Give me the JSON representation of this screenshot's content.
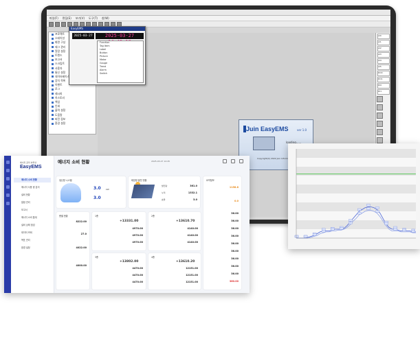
{
  "colors": {
    "accent": "#1a3fb8",
    "nav": "#2a3ba8",
    "clock": "#ff3a9a",
    "limit_line": "#2ec02e",
    "series_line": "#4a64d8"
  },
  "monitor_app": {
    "menu": [
      "파일(F)",
      "편집(E)",
      "보기(V)",
      "도구(T)",
      "창(W)"
    ],
    "tree_items": [
      "프로젝트",
      "스테이션",
      "화면 구성",
      "태그 관리",
      "알람 설정",
      "트렌드",
      "보고서",
      "스크립트",
      "사용자",
      "통신 설정",
      "데이터베이스",
      "장치 목록",
      "이벤트",
      "로그",
      "레시피",
      "히스토리",
      "백업",
      "인쇄",
      "출력 설정",
      "도움말",
      "버전 정보",
      "환경 설정"
    ],
    "clock_label": "2025-03-27",
    "clock": "2025-03-27 14:45:18",
    "popup_items": [
      "Function",
      "Tag Item",
      "Label",
      "Button",
      "Picture",
      "Meter",
      "Gauge",
      "Trend",
      "Alarm",
      "Switch"
    ],
    "right_cells": [
      "AI0",
      "AI1",
      "AI2",
      "AI3",
      "AI4",
      "AI5",
      "DO0",
      "DO1",
      "DI0",
      "DI1"
    ],
    "splash": {
      "brand": "Juin EasyEMS",
      "version": "ver 1.0",
      "loading": "loading......",
      "copyright": "Copyright(C) 2022 Juin Information System Co.,Ltd."
    }
  },
  "dashboard": {
    "brand_sub": "에너지 관리 솔루션",
    "brand": "EasyEMS",
    "title": "에너지 소비 현황",
    "topbar": "2025-03-27 14:45",
    "menu": [
      "에너지 소비 현황",
      "에너지 사용 량 분석",
      "설비 현황",
      "알람 관리",
      "보고서",
      "에너지 소비 통계",
      "설비 상태 점검",
      "데이터 조회",
      "목표 관리",
      "환경 설정"
    ],
    "card_heat": {
      "title": "냉난방 시스템",
      "v1": "3.0",
      "v2": "3.0",
      "unit": "kW"
    },
    "card_solar": {
      "title": "태양광 발전 현황",
      "rows": [
        {
          "k": "발전량",
          "v": "361.0"
        },
        {
          "k": "누적",
          "v": "1332.1"
        },
        {
          "k": "효율",
          "v": "3.0"
        }
      ]
    },
    "card_summary": {
      "title": "요약정보",
      "r1": "1158.8",
      "r2": "0.0"
    },
    "right_rows": [
      "36.00",
      "36.00",
      "36.00",
      "36.00",
      "36.00",
      "36.00",
      "36.00",
      "36.00",
      "36.00",
      "360.00"
    ],
    "block_a": {
      "title": "층별 현황",
      "vals": [
        "8222.00",
        "27.0",
        "4022.00",
        "4000.00"
      ]
    },
    "block_b": {
      "title": "1층",
      "big": "+13331.00",
      "vals": [
        "4970.00",
        "4970.00",
        "4970.00"
      ]
    },
    "block_c": {
      "title": "2층",
      "big": "+13610.70",
      "vals": [
        "4140.00",
        "4140.00",
        "4140.00"
      ]
    },
    "block_d": {
      "title": "3층",
      "big": "+13802.00",
      "vals": [
        "4470.00",
        "4470.00",
        "4470.00"
      ]
    },
    "block_e": {
      "title": "4층",
      "big": "+13610.20",
      "vals": [
        "12151.00",
        "12151.00",
        "12151.00"
      ]
    }
  },
  "chart_data": {
    "type": "line",
    "x": [
      0,
      1,
      2,
      3,
      4,
      5,
      6,
      7,
      8,
      9,
      10,
      11,
      12,
      13,
      14,
      15,
      16,
      17,
      18,
      19,
      20,
      21,
      22,
      23,
      24,
      25,
      26,
      27,
      28,
      29,
      30,
      31,
      32,
      33,
      34,
      35,
      36,
      37,
      38,
      39,
      40
    ],
    "series": [
      {
        "values": [
          0,
          0,
          0,
          0,
          1,
          2,
          3,
          5,
          7,
          8,
          8,
          8,
          9,
          10,
          10,
          10,
          11,
          14,
          18,
          22,
          26,
          30,
          32,
          34,
          35,
          35,
          34,
          32,
          28,
          22,
          16,
          12,
          10,
          10,
          9,
          8,
          8,
          8,
          8,
          7,
          7
        ]
      },
      {
        "values": [
          0,
          0,
          0,
          0,
          0,
          1,
          2,
          3,
          5,
          6,
          7,
          7,
          8,
          8,
          9,
          9,
          10,
          12,
          15,
          19,
          22,
          26,
          28,
          30,
          31,
          31,
          30,
          28,
          24,
          19,
          14,
          10,
          8,
          8,
          8,
          7,
          7,
          7,
          7,
          6,
          6
        ]
      }
    ],
    "limit": 72,
    "ylim": [
      0,
      100
    ]
  }
}
